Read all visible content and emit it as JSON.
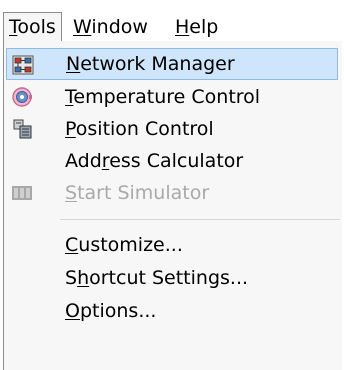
{
  "menubar": {
    "items": [
      {
        "pre": "",
        "u": "T",
        "post": "ools"
      },
      {
        "pre": "",
        "u": "W",
        "post": "indow"
      },
      {
        "pre": "",
        "u": "H",
        "post": "elp"
      }
    ]
  },
  "menu": {
    "items": [
      {
        "pre": "",
        "u": "N",
        "post": "etwork Manager",
        "icon": "network-manager-icon",
        "disabled": false,
        "highlighted": true
      },
      {
        "pre": "",
        "u": "T",
        "post": "emperature Control",
        "icon": "temperature-control-icon",
        "disabled": false,
        "highlighted": false
      },
      {
        "pre": "",
        "u": "P",
        "post": "osition Control",
        "icon": "position-control-icon",
        "disabled": false,
        "highlighted": false
      },
      {
        "pre": "Add",
        "u": "r",
        "post": "ess Calculator",
        "icon": "",
        "disabled": false,
        "highlighted": false
      },
      {
        "pre": "",
        "u": "S",
        "post": "tart Simulator",
        "icon": "start-simulator-icon",
        "disabled": true,
        "highlighted": false
      },
      {
        "pre": "",
        "u": "C",
        "post": "ustomize...",
        "icon": "",
        "disabled": false,
        "highlighted": false
      },
      {
        "pre": "S",
        "u": "h",
        "post": "ortcut Settings...",
        "icon": "",
        "disabled": false,
        "highlighted": false
      },
      {
        "pre": "",
        "u": "O",
        "post": "ptions...",
        "icon": "",
        "disabled": false,
        "highlighted": false
      }
    ]
  },
  "colors": {
    "highlight_bg": "#cfe5fb",
    "highlight_border": "#8fbbe8",
    "disabled_text": "#a9a9a9",
    "menu_bg": "#f7f7f7"
  }
}
